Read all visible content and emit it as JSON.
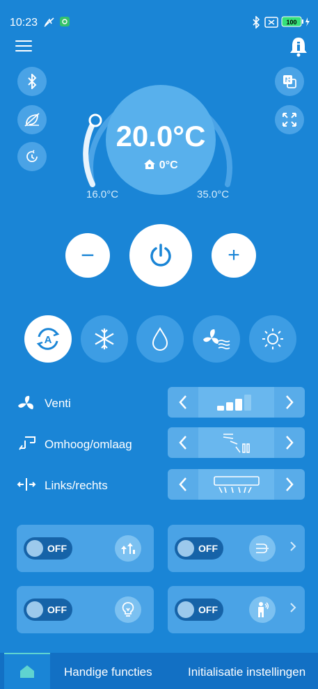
{
  "status_bar": {
    "time": "10:23",
    "battery": "100"
  },
  "header": {
    "menu_icon": "hamburger-icon",
    "notification_icon": "bell-info-icon"
  },
  "left_side_buttons": [
    "bluetooth-icon",
    "eco-off-icon",
    "timer-icon"
  ],
  "right_side_buttons": [
    "m-mode-icon",
    "expand-icon"
  ],
  "thermostat": {
    "set_temp": "20.0°C",
    "indoor_temp": "0°C",
    "min": "16.0°C",
    "max": "35.0°C"
  },
  "controls": {
    "minus": "−",
    "plus": "+"
  },
  "modes": [
    {
      "name": "auto",
      "active": true
    },
    {
      "name": "cool",
      "active": false
    },
    {
      "name": "dry",
      "active": false
    },
    {
      "name": "fan",
      "active": false
    },
    {
      "name": "heat",
      "active": false
    }
  ],
  "rows": {
    "fan": {
      "label": "Venti"
    },
    "vertical": {
      "label": "Omhoog/omlaag"
    },
    "horizontal": {
      "label": "Links/rechts"
    }
  },
  "cards": [
    {
      "state": "OFF",
      "icon": "boost-arrows-icon",
      "chevron": false
    },
    {
      "state": "OFF",
      "icon": "airflow-icon",
      "chevron": true
    },
    {
      "state": "OFF",
      "icon": "light-bulb-icon",
      "chevron": false
    },
    {
      "state": "OFF",
      "icon": "person-sensor-icon",
      "chevron": true
    }
  ],
  "bottom_nav": {
    "tab2": "Handige functies",
    "tab3": "Initialisatie instellingen"
  },
  "colors": {
    "background": "#1a85d6",
    "accent_white": "#ffffff",
    "nav_indicator": "#5fd3d0"
  }
}
